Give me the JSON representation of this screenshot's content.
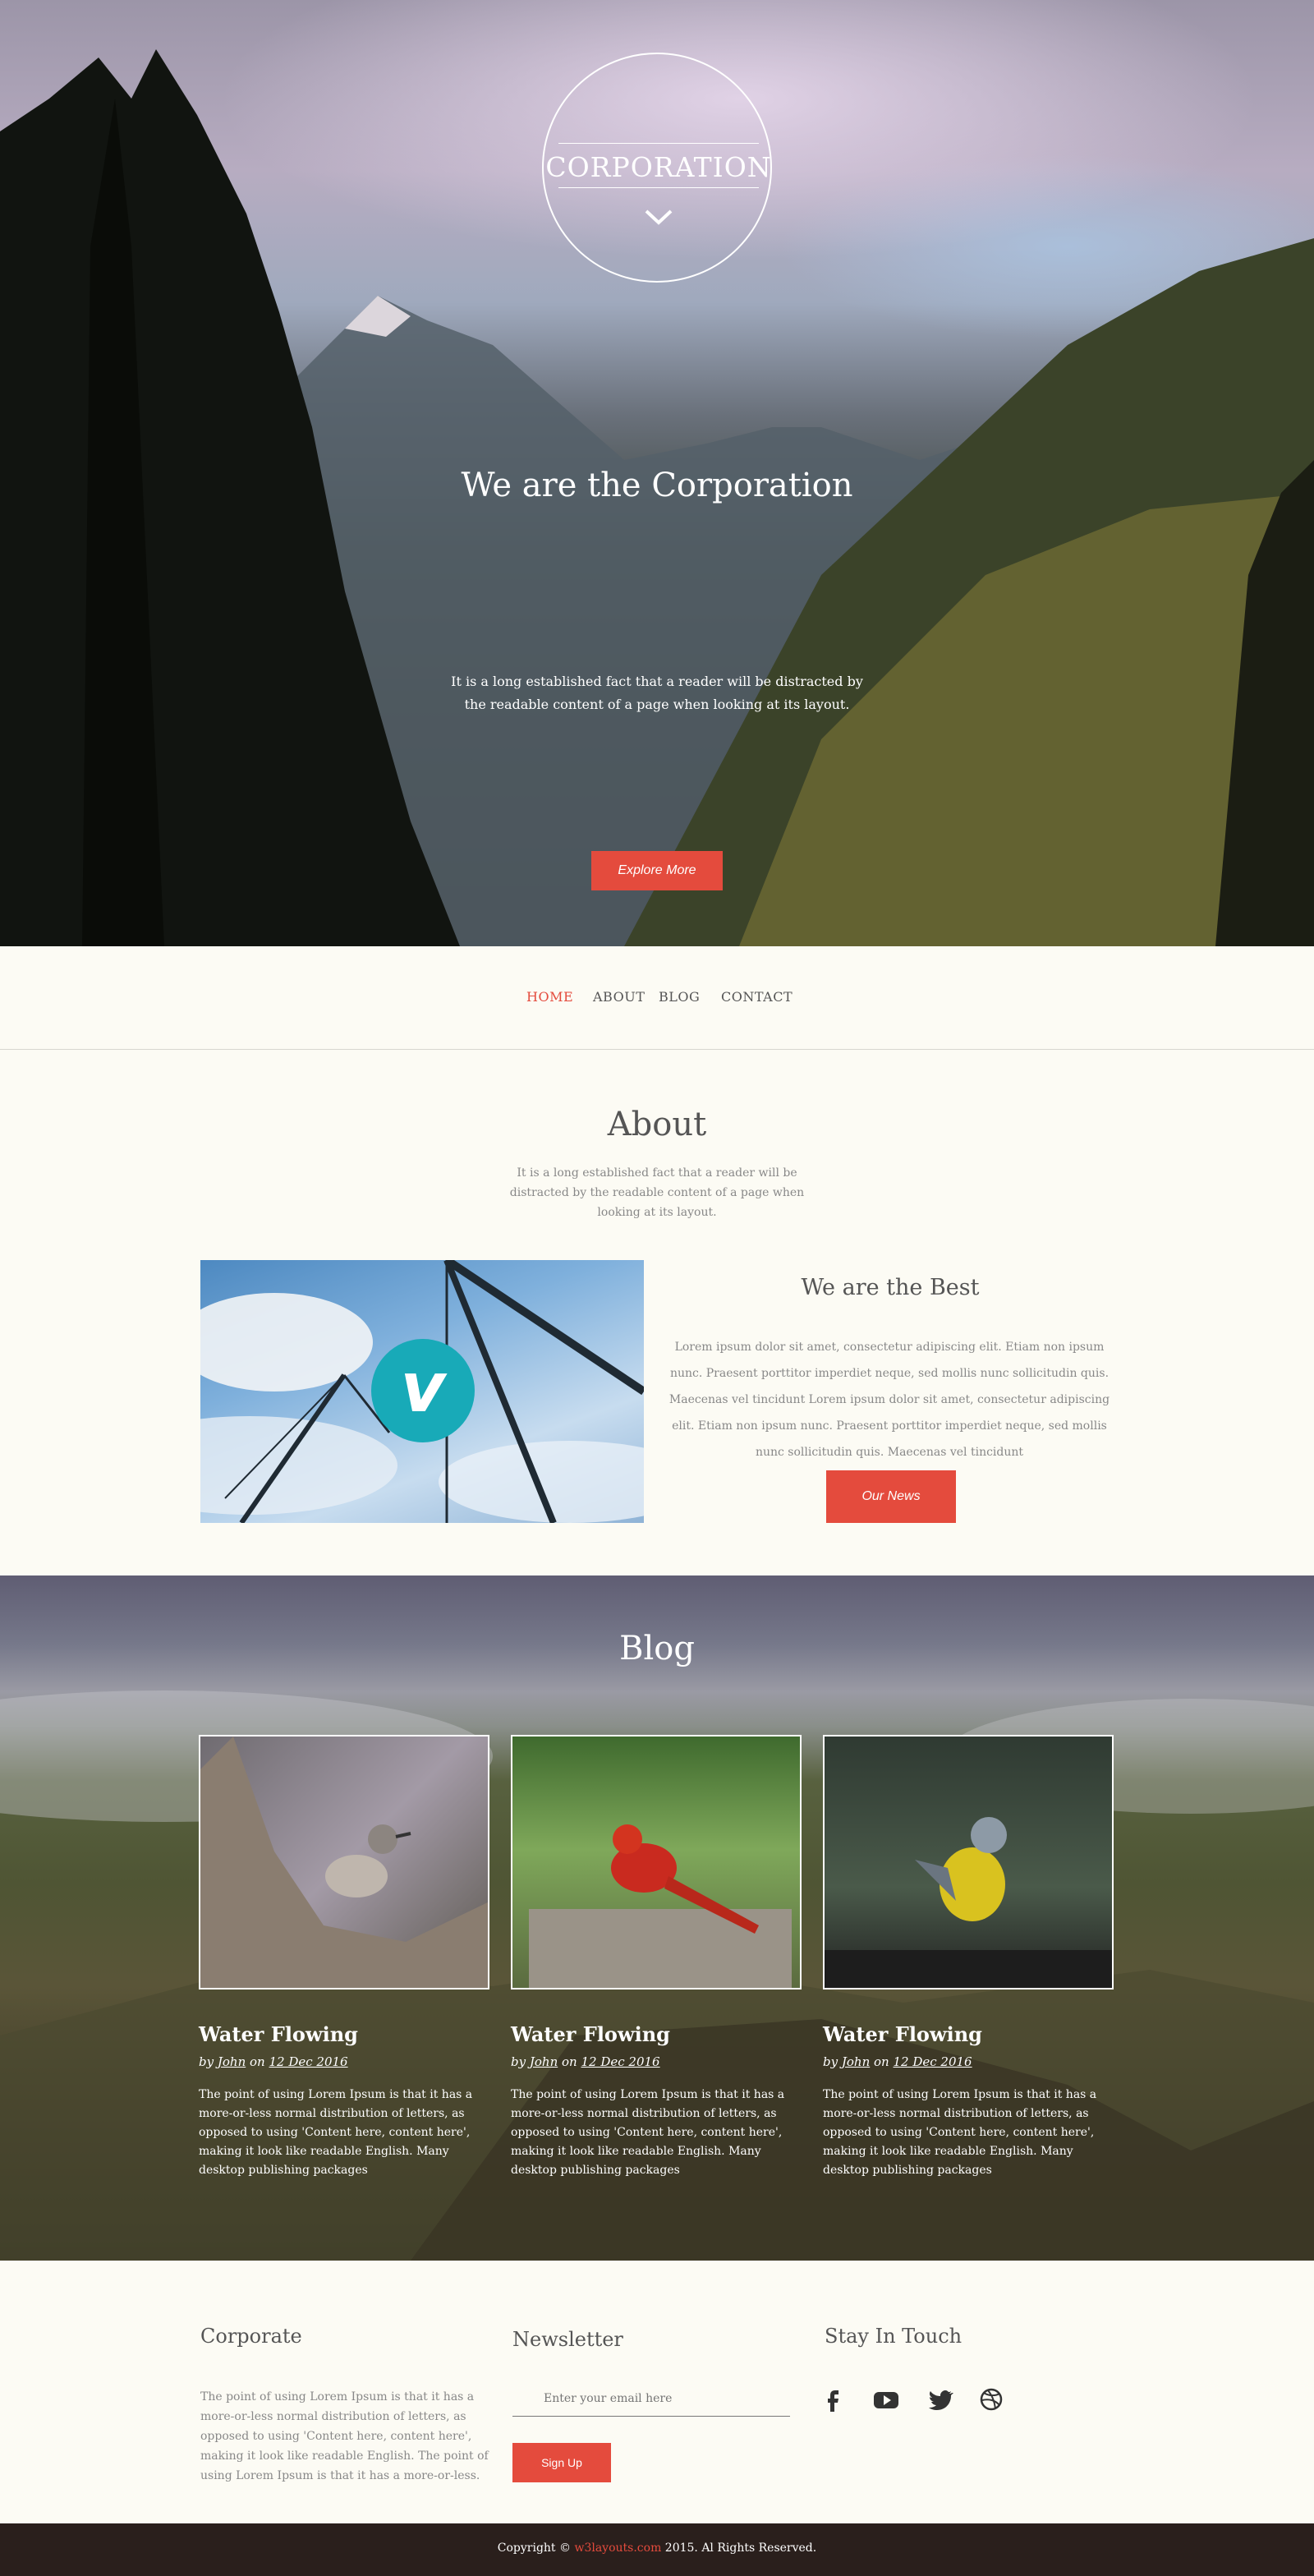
{
  "hero": {
    "logo": "CORPORATION",
    "title": "We are the Corporation",
    "subtitle": "It is a long established fact that a reader will be distracted by the readable content of a page when looking at its layout.",
    "button": "Explore More"
  },
  "nav": {
    "items": [
      "HOME",
      "ABOUT",
      "BLOG",
      "CONTACT"
    ],
    "active": "HOME"
  },
  "about": {
    "title": "About",
    "desc": "It is a long established fact that a reader will be distracted by the readable content of a page when looking at its layout.",
    "video_icon": "vimeo-icon",
    "best_title": "We are the Best",
    "best_text": "Lorem ipsum dolor sit amet, consectetur adipiscing elit. Etiam non ipsum nunc. Praesent porttitor imperdiet neque, sed mollis nunc sollicitudin quis. Maecenas vel tincidunt Lorem ipsum dolor sit amet, consectetur adipiscing elit. Etiam non ipsum nunc. Praesent porttitor imperdiet neque, sed mollis nunc sollicitudin quis. Maecenas vel tincidunt",
    "button": "Our News"
  },
  "blog": {
    "title": "Blog",
    "posts": [
      {
        "title": "Water Flowing",
        "by": "by",
        "author": "John",
        "on": "on",
        "date": "12 Dec 2016",
        "text": "The point of using Lorem Ipsum is that it has a more-or-less normal distribution of letters, as opposed to using 'Content here, content here', making it look like readable English. Many desktop publishing packages"
      },
      {
        "title": "Water Flowing",
        "by": "by",
        "author": "John",
        "on": "on",
        "date": "12 Dec 2016",
        "text": "The point of using Lorem Ipsum is that it has a more-or-less normal distribution of letters, as opposed to using 'Content here, content here', making it look like readable English. Many desktop publishing packages"
      },
      {
        "title": "Water Flowing",
        "by": "by",
        "author": "John",
        "on": "on",
        "date": "12 Dec 2016",
        "text": "The point of using Lorem Ipsum is that it has a more-or-less normal distribution of letters, as opposed to using 'Content here, content here', making it look like readable English. Many desktop publishing packages"
      }
    ]
  },
  "footer": {
    "corporate_title": "Corporate",
    "corporate_text": "The point of using Lorem Ipsum is that it has a more-or-less normal distribution of letters, as opposed to using 'Content here, content here', making it look like readable English. The point of using Lorem Ipsum is that it has a more-or-less.",
    "newsletter_title": "Newsletter",
    "email_placeholder": "Enter your email here",
    "signup": "Sign Up",
    "stay_title": "Stay In Touch",
    "social_icons": [
      "facebook-icon",
      "youtube-icon",
      "twitter-icon",
      "dribbble-icon"
    ]
  },
  "copyright": {
    "prefix": "Copyright ©",
    "link": "w3layouts.com",
    "suffix": "2015. Al Rights Reserved."
  },
  "colors": {
    "accent": "#e44b3d",
    "background": "#fcfbf4",
    "vimeo": "#18aab8",
    "footer_bar": "#2a1f1c"
  }
}
